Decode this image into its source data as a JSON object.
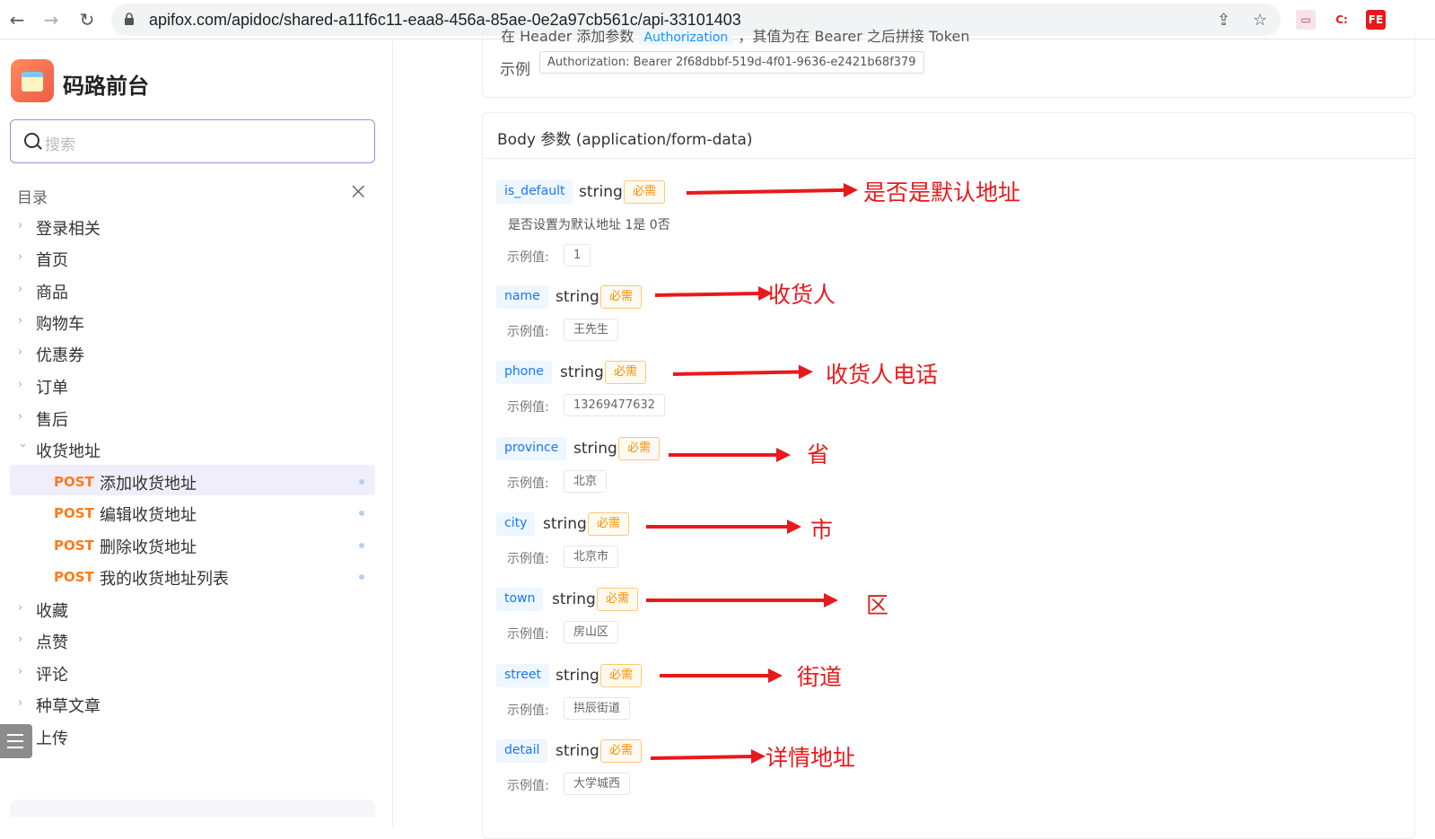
{
  "browser": {
    "url": "apifox.com/apidoc/shared-a11f6c11-eaa8-456a-85ae-0e2a97cb561c/api-33101403",
    "ext1": "C:",
    "ext2": "FE"
  },
  "sidebar": {
    "brand": "码路前台",
    "search_placeholder": "搜索",
    "toc_title": "目录",
    "folders_top": [
      "登录相关",
      "首页",
      "商品",
      "购物车",
      "优惠券",
      "订单",
      "售后",
      "收货地址"
    ],
    "endpoints": [
      {
        "method": "POST",
        "label": "添加收货地址"
      },
      {
        "method": "POST",
        "label": "编辑收货地址"
      },
      {
        "method": "POST",
        "label": "删除收货地址"
      },
      {
        "method": "POST",
        "label": "我的收货地址列表"
      }
    ],
    "folders_bottom": [
      "收藏",
      "点赞",
      "评论",
      "种草文章",
      "上传"
    ]
  },
  "auth": {
    "note_prefix": "在 Header 添加参数",
    "note_tag": "Authorization",
    "note_suffix": "，其值为在 Bearer 之后拼接 Token",
    "example_label": "示例",
    "example_value": "Authorization: Bearer 2f68dbbf-519d-4f01-9636-e2421b68f379"
  },
  "body": {
    "title": "Body 参数 (application/form-data)",
    "example_label": "示例值:",
    "params": [
      {
        "name": "is_default",
        "type": "string",
        "required": "必需",
        "desc": "是否设置为默认地址 1是 0否",
        "example": "1",
        "annotation": "是否是默认地址"
      },
      {
        "name": "name",
        "type": "string",
        "required": "必需",
        "desc": "",
        "example": "王先生",
        "annotation": "收货人"
      },
      {
        "name": "phone",
        "type": "string",
        "required": "必需",
        "desc": "",
        "example": "13269477632",
        "annotation": "收货人电话"
      },
      {
        "name": "province",
        "type": "string",
        "required": "必需",
        "desc": "",
        "example": "北京",
        "annotation": "省"
      },
      {
        "name": "city",
        "type": "string",
        "required": "必需",
        "desc": "",
        "example": "北京市",
        "annotation": "市"
      },
      {
        "name": "town",
        "type": "string",
        "required": "必需",
        "desc": "",
        "example": "房山区",
        "annotation": "区"
      },
      {
        "name": "street",
        "type": "string",
        "required": "必需",
        "desc": "",
        "example": "拱辰街道",
        "annotation": "街道"
      },
      {
        "name": "detail",
        "type": "string",
        "required": "必需",
        "desc": "",
        "example": "大学城西",
        "annotation": "详情地址"
      }
    ]
  },
  "colors": {
    "accent": "#1677ff",
    "post": "#ff7a1a",
    "required": "#ff8c00",
    "annotation": "#e8191b"
  }
}
